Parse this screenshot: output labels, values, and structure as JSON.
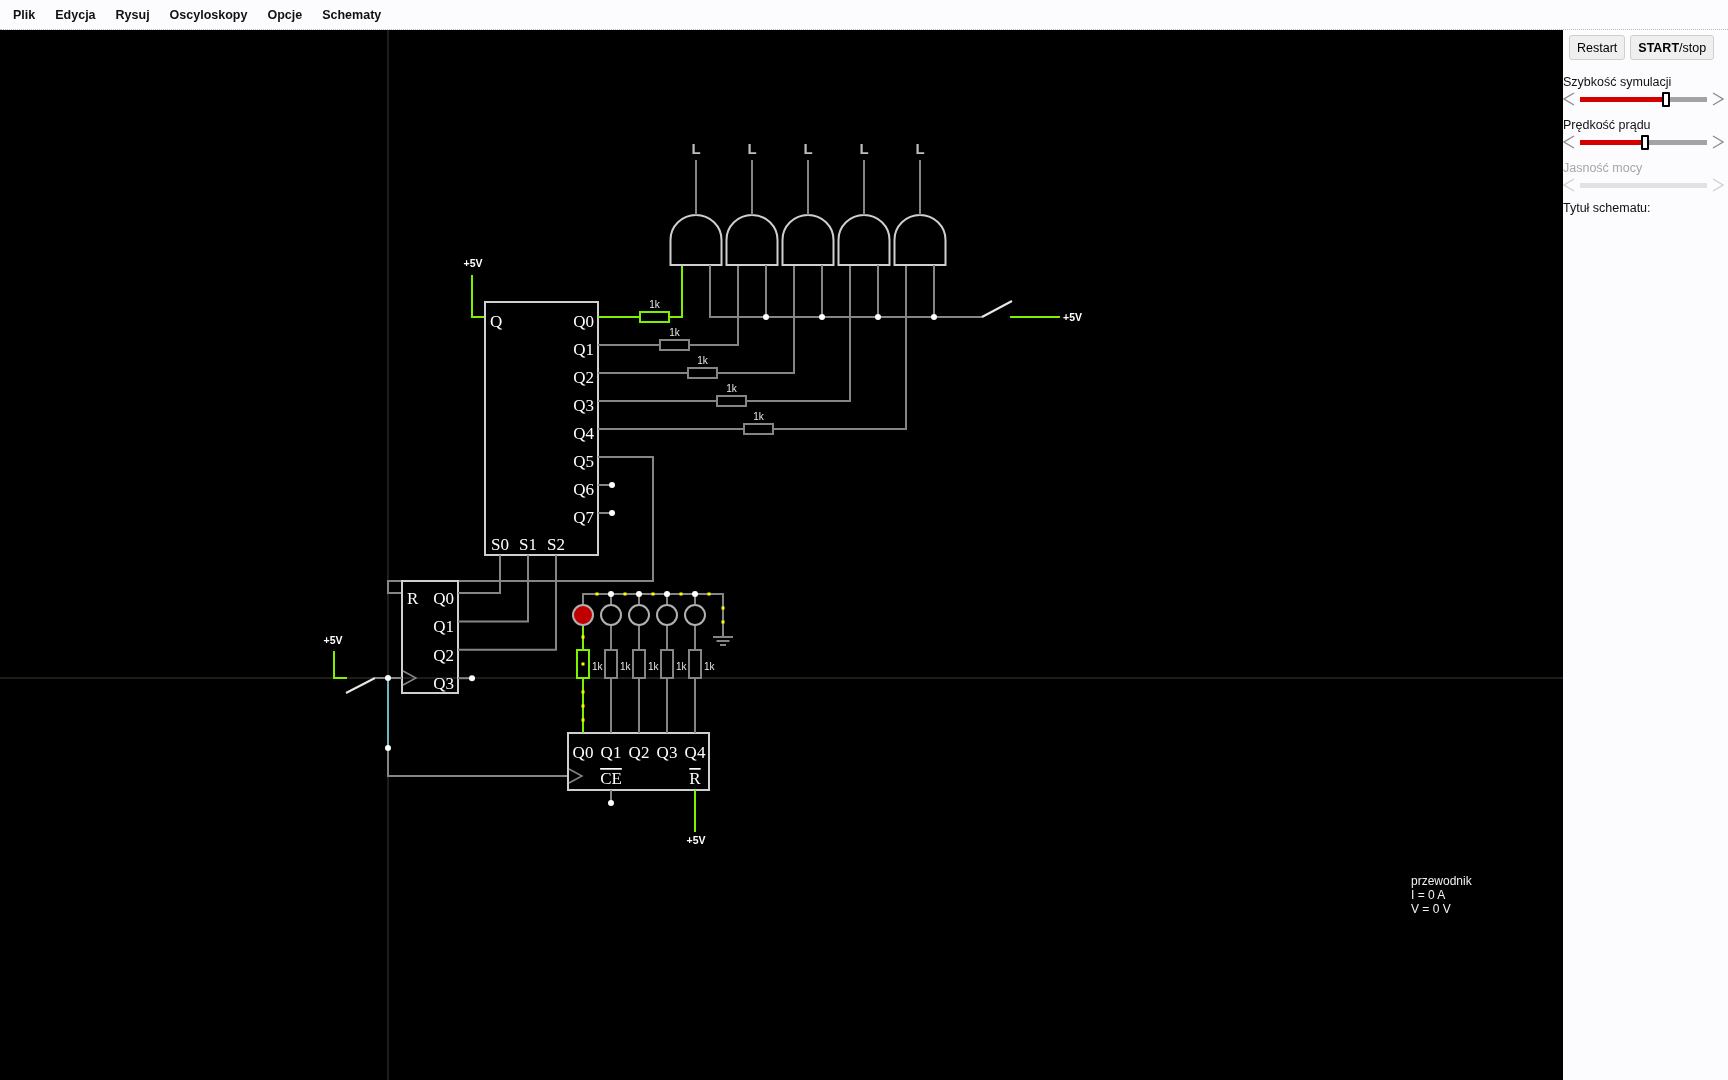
{
  "menu": [
    "Plik",
    "Edycja",
    "Rysuj",
    "Oscyloskopy",
    "Opcje",
    "Schematy"
  ],
  "circuit": {
    "shift_register": {
      "supply": "+5V",
      "input": "Q",
      "outputs": [
        "Q0",
        "Q1",
        "Q2",
        "Q3",
        "Q4",
        "Q5",
        "Q6",
        "Q7"
      ],
      "selects": [
        "S0",
        "S1",
        "S2"
      ]
    },
    "and_gates": [
      {
        "output": "L"
      },
      {
        "output": "L"
      },
      {
        "output": "L"
      },
      {
        "output": "L"
      },
      {
        "output": "L"
      }
    ],
    "gate_resistors": [
      {
        "value": "1k",
        "high": true
      },
      {
        "value": "1k",
        "high": false
      },
      {
        "value": "1k",
        "high": false
      },
      {
        "value": "1k",
        "high": false
      },
      {
        "value": "1k",
        "high": false
      }
    ],
    "enable_switch": {
      "supply": "+5V",
      "closed": false
    },
    "counter": {
      "reset": "R",
      "outputs": [
        "Q0",
        "Q1",
        "Q2",
        "Q3"
      ]
    },
    "clock_switch": {
      "supply": "+5V",
      "closed": false
    },
    "clock_wire": {
      "highlighted": true
    },
    "leds": [
      {
        "lit": true,
        "resistor": "1k"
      },
      {
        "lit": false,
        "resistor": "1k"
      },
      {
        "lit": false,
        "resistor": "1k"
      },
      {
        "lit": false,
        "resistor": "1k"
      },
      {
        "lit": false,
        "resistor": "1k"
      }
    ],
    "decade_counter": {
      "outputs": [
        "Q0",
        "Q1",
        "Q2",
        "Q3",
        "Q4"
      ],
      "enable": {
        "label": "CE",
        "inverted": true
      },
      "reset": {
        "label": "R",
        "inverted": true
      },
      "supply": "+5V"
    }
  },
  "info": [
    "przewodnik",
    "I = 0 A",
    "V = 0 V"
  ],
  "panel": {
    "buttons": [
      "Restart",
      "**START**/stop"
    ],
    "sliders": [
      {
        "label": "Szybkość symulacji",
        "level": 0.68,
        "disabled": false
      },
      {
        "label": "Prędkość prądu",
        "level": 0.51,
        "disabled": false
      },
      {
        "label": "Jasność mocy",
        "disabled": true
      }
    ],
    "title_label": "Tytuł schematu:"
  }
}
